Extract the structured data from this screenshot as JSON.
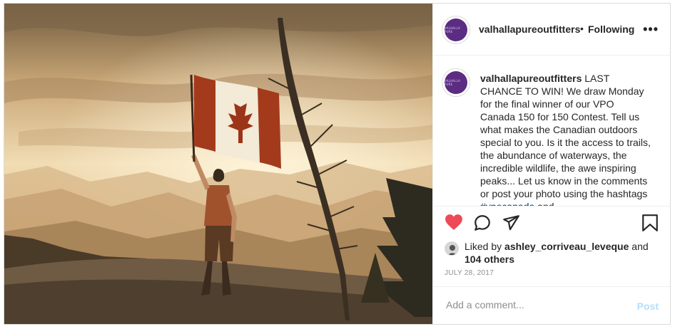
{
  "account": {
    "username": "valhallapureoutfitters",
    "avatar_text": "VALHALLA PURE",
    "follow_status": "Following",
    "separator": "•"
  },
  "caption": {
    "username": "valhallapureoutfitters",
    "body": " LAST CHANCE TO WIN! We draw Monday for the final winner of our VPO Canada 150 for 150 Contest. Tell us what makes the Canadian outdoors special to you. Is it the access to trails, the abundance of waterways, the incredible wildlife, the awe inspiring peaks... Let us know in the comments or post your photo using the hashtags ",
    "hashtag": "#vpocanada",
    "trailing": "  and"
  },
  "likes": {
    "prefix": "Liked by ",
    "user": "ashley_corriveau_leveque",
    "conj": " and",
    "others": "104 others"
  },
  "date": "JULY 28, 2017",
  "comment": {
    "placeholder": "Add a comment...",
    "post_label": "Post"
  },
  "icons": {
    "like": "heart-icon",
    "comment": "comment-icon",
    "share": "share-icon",
    "save": "bookmark-icon",
    "more": "more-options-icon"
  },
  "colors": {
    "liked_heart": "#ed4956",
    "post_button_disabled": "#b2dffc",
    "hashtag": "#00376b",
    "avatar_brand": "#5b2c82"
  },
  "more_glyph": "•••"
}
